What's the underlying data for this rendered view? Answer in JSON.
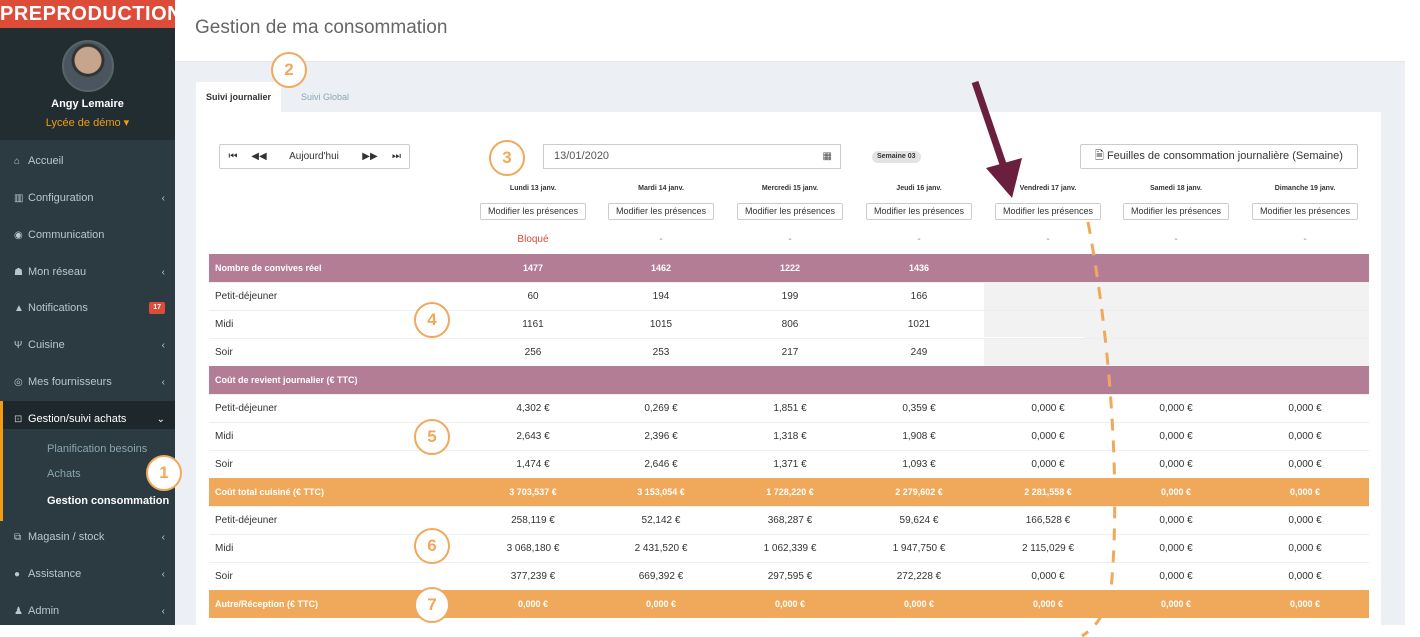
{
  "env_label": "PREPRODUCTION",
  "user": {
    "name": "Angy Lemaire",
    "school": "Lycée de démo ▾"
  },
  "sidebar": {
    "items": [
      {
        "label": "Accueil",
        "icon": "home-icon",
        "glyph": "⌂",
        "chevron": ""
      },
      {
        "label": "Configuration",
        "icon": "bank-icon",
        "glyph": "▥",
        "chevron": "‹"
      },
      {
        "label": "Communication",
        "icon": "comments-icon",
        "glyph": "◉",
        "chevron": ""
      },
      {
        "label": "Mon réseau",
        "icon": "users-icon",
        "glyph": "☗",
        "chevron": "‹"
      },
      {
        "label": "Notifications",
        "icon": "bell-icon",
        "glyph": "▲",
        "badge": "17"
      },
      {
        "label": "Cuisine",
        "icon": "cutlery-icon",
        "glyph": "Ψ",
        "chevron": "‹"
      },
      {
        "label": "Mes fournisseurs",
        "icon": "eye-icon",
        "glyph": "◎",
        "chevron": "‹"
      },
      {
        "label": "Gestion/suivi achats",
        "icon": "cart-icon",
        "glyph": "⊡",
        "chevron": "⌄"
      },
      {
        "label": "Magasin / stock",
        "icon": "cubes-icon",
        "glyph": "⧉",
        "chevron": "‹"
      },
      {
        "label": "Assistance",
        "icon": "info-icon",
        "glyph": "●",
        "chevron": "‹"
      },
      {
        "label": "Admin",
        "icon": "user-plus-icon",
        "glyph": "♟",
        "chevron": "‹"
      }
    ],
    "submenu": [
      "Planification besoins",
      "Achats",
      "Gestion consommation"
    ]
  },
  "page_title": "Gestion de ma consommation",
  "tabs": [
    "Suivi journalier",
    "Suivi Global"
  ],
  "toolbar": {
    "first": "⏮",
    "prev": "◀◀",
    "today": "Aujourd'hui",
    "next": "▶▶",
    "last": "⏭",
    "date": "13/01/2020",
    "calendar_glyph": "▦",
    "week": "Semaine 03",
    "sheets_label": "Feuilles de consommation journalière (Semaine)",
    "sheets_glyph": "🗎"
  },
  "days": [
    {
      "label": "Lundi 13 janv.",
      "button": "Modifier les présences",
      "status": "Bloqué"
    },
    {
      "label": "Mardi 14 janv.",
      "button": "Modifier les présences",
      "status": "-"
    },
    {
      "label": "Mercredi 15 janv.",
      "button": "Modifier les présences",
      "status": "-"
    },
    {
      "label": "Jeudi 16 janv.",
      "button": "Modifier les présences",
      "status": "-"
    },
    {
      "label": "Vendredi 17 janv.",
      "button": "Modifier les présences",
      "status": "-"
    },
    {
      "label": "Samedi 18 janv.",
      "button": "Modifier les présences",
      "status": "-"
    },
    {
      "label": "Dimanche 19 janv.",
      "button": "Modifier les présences",
      "status": "-"
    }
  ],
  "table": {
    "rows": [
      {
        "type": "hdr-purple",
        "label": "Nombre de convives réel",
        "values": [
          "1477",
          "1462",
          "1222",
          "1436",
          "",
          "",
          ""
        ]
      },
      {
        "type": "body",
        "label": "Petit-déjeuner",
        "values": [
          "60",
          "194",
          "199",
          "166",
          "",
          "",
          ""
        ]
      },
      {
        "type": "body",
        "label": "Midi",
        "values": [
          "1161",
          "1015",
          "806",
          "1021",
          "",
          "",
          ""
        ]
      },
      {
        "type": "body",
        "label": "Soir",
        "values": [
          "256",
          "253",
          "217",
          "249",
          "",
          "",
          ""
        ]
      },
      {
        "type": "hdr-purple",
        "label": "Coût de revient journalier (€ TTC)",
        "values": [
          "",
          "",
          "",
          "",
          "",
          "",
          ""
        ]
      },
      {
        "type": "body",
        "label": "Petit-déjeuner",
        "values": [
          "4,302 €",
          "0,269 €",
          "1,851 €",
          "0,359 €",
          "0,000 €",
          "0,000 €",
          "0,000 €"
        ]
      },
      {
        "type": "body",
        "label": "Midi",
        "values": [
          "2,643 €",
          "2,396 €",
          "1,318 €",
          "1,908 €",
          "0,000 €",
          "0,000 €",
          "0,000 €"
        ]
      },
      {
        "type": "body",
        "label": "Soir",
        "values": [
          "1,474 €",
          "2,646 €",
          "1,371 €",
          "1,093 €",
          "0,000 €",
          "0,000 €",
          "0,000 €"
        ]
      },
      {
        "type": "hdr-orange",
        "label": "Coût total cuisiné (€ TTC)",
        "values": [
          "3 703,537 €",
          "3 153,054 €",
          "1 728,220 €",
          "2 279,602 €",
          "2 281,558 €",
          "0,000 €",
          "0,000 €"
        ]
      },
      {
        "type": "body",
        "label": "Petit-déjeuner",
        "values": [
          "258,119 €",
          "52,142 €",
          "368,287 €",
          "59,624 €",
          "166,528 €",
          "0,000 €",
          "0,000 €"
        ]
      },
      {
        "type": "body",
        "label": "Midi",
        "values": [
          "3 068,180 €",
          "2 431,520 €",
          "1 062,339 €",
          "1 947,750 €",
          "2 115,029 €",
          "0,000 €",
          "0,000 €"
        ]
      },
      {
        "type": "body",
        "label": "Soir",
        "values": [
          "377,239 €",
          "669,392 €",
          "297,595 €",
          "272,228 €",
          "0,000 €",
          "0,000 €",
          "0,000 €"
        ]
      },
      {
        "type": "hdr-orange",
        "label": "Autre/Réception (€ TTC)",
        "values": [
          "0,000 €",
          "0,000 €",
          "0,000 €",
          "0,000 €",
          "0,000 €",
          "0,000 €",
          "0,000 €"
        ]
      }
    ]
  },
  "annotations": [
    "1",
    "2",
    "3",
    "4",
    "5",
    "6",
    "7"
  ],
  "colors": {
    "sidebar_bg": "#2c3b41",
    "env_red": "#dd4b39",
    "accent_orange": "#f39c12",
    "row_purple": "#b37d95",
    "row_orange": "#f0a95a",
    "arrow": "#6b1f3f"
  }
}
